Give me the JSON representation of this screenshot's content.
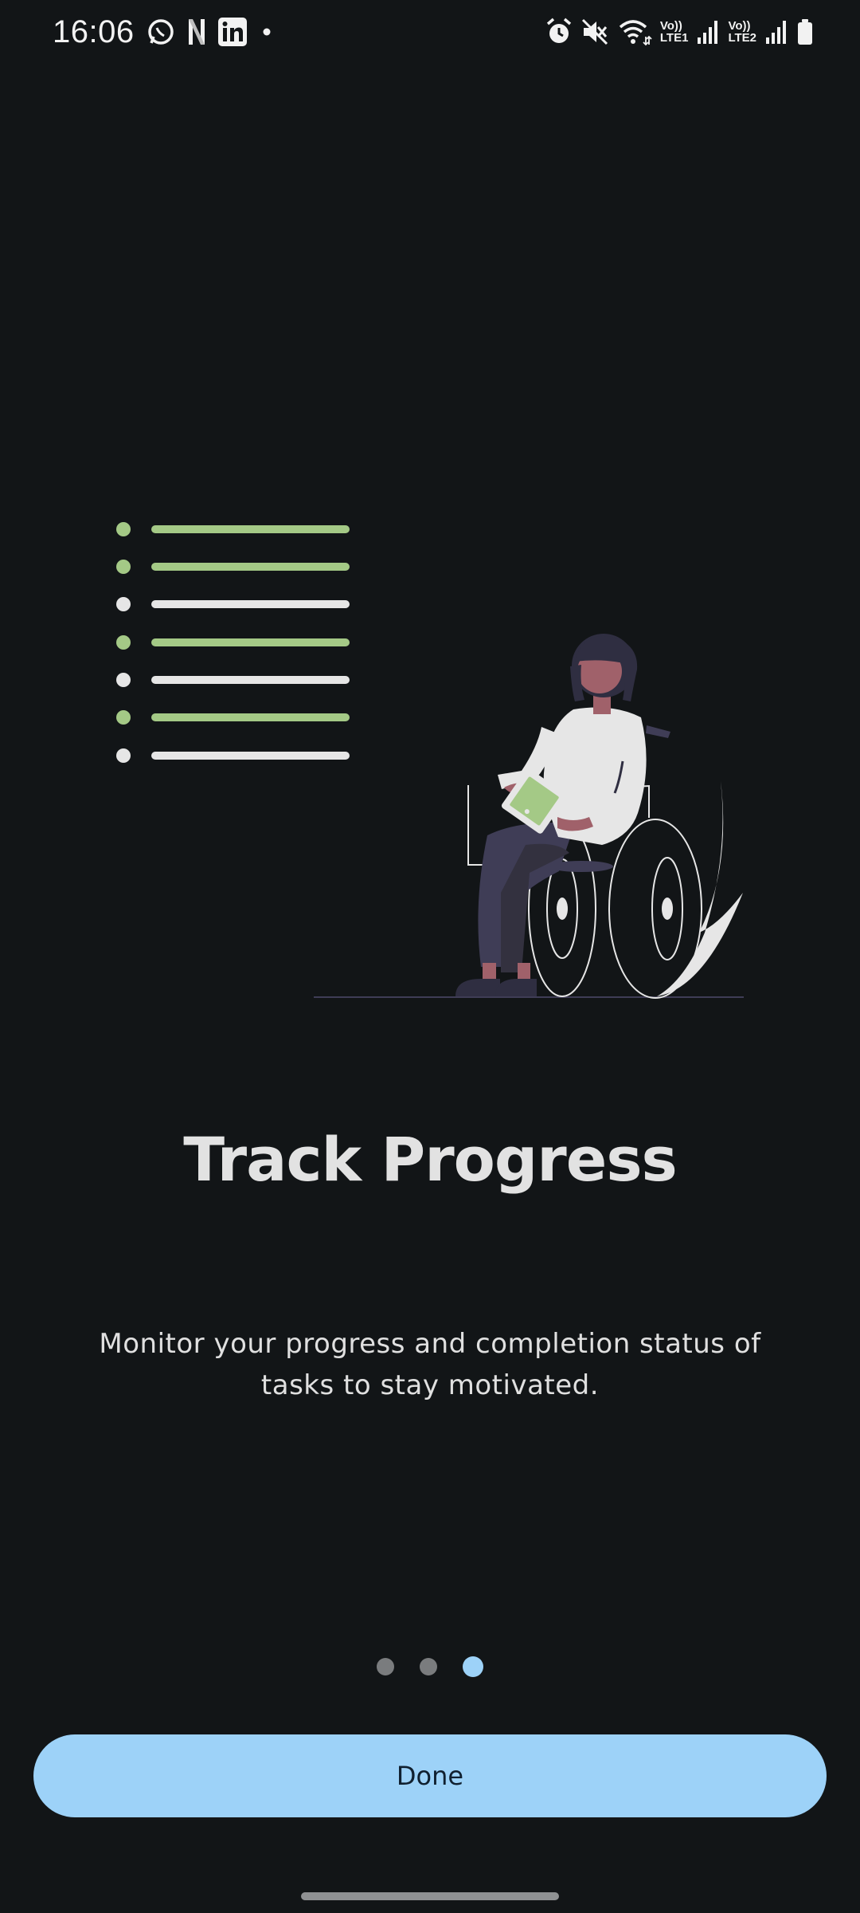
{
  "status_bar": {
    "time": "16:06",
    "left_icons": [
      "whatsapp-icon",
      "netflix-icon",
      "linkedin-icon",
      "notification-dot-icon"
    ],
    "right_icons": [
      "alarm-icon",
      "mute-icon",
      "wifi-icon",
      "signal-sim1-icon",
      "signal-sim2-icon",
      "battery-icon"
    ],
    "sim1_top": "Vo))",
    "sim1_bottom": "LTE1",
    "sim2_top": "Vo))",
    "sim2_bottom": "LTE2"
  },
  "onboarding": {
    "title": "Track Progress",
    "description": "Monitor your progress and completion status of tasks to stay motivated.",
    "page_count": 3,
    "current_page": 3
  },
  "actions": {
    "done_label": "Done"
  },
  "colors": {
    "background": "#121517",
    "accent": "#9dd2f8",
    "checklist_done": "#a4c986",
    "checklist_pending": "#e6e6e6"
  }
}
